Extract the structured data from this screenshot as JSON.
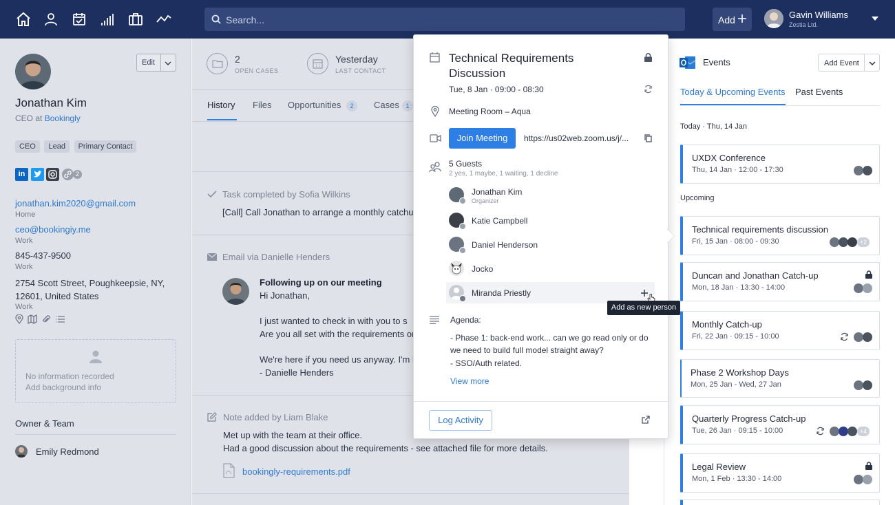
{
  "topbar": {
    "search_placeholder": "Search...",
    "add_label": "Add",
    "user_name": "Gavin Williams",
    "user_company": "Zestia Ltd."
  },
  "contact": {
    "edit_label": "Edit",
    "name": "Jonathan Kim",
    "role_prefix": "CEO at",
    "company": "Bookingly",
    "tags": [
      "CEO",
      "Lead",
      "Primary Contact"
    ],
    "social_more": "2",
    "email1": "jonathan.kim2020@gmail.com",
    "email1_type": "Home",
    "email2": "ceo@bookingiy.me",
    "email2_type": "Work",
    "phone": "845-437-9500",
    "phone_type": "Work",
    "address_line1": "2754 Scott Street, Poughkeepsie, NY,",
    "address_line2": "12601, United States",
    "address_type": "Work",
    "bg_empty": "No information recorded",
    "bg_add": "Add background info",
    "owner_heading": "Owner & Team",
    "owner_name": "Emily Redmond"
  },
  "stats": {
    "open_cases_value": "2",
    "open_cases_label": "OPEN CASES",
    "last_contact_value": "Yesterday",
    "last_contact_label": "LAST CONTACT"
  },
  "tabs": {
    "history": "History",
    "files": "Files",
    "opportunities": "Opportunities",
    "opportunities_count": "2",
    "cases": "Cases",
    "cases_count": "1"
  },
  "feed": {
    "task_header": "Task completed by Sofia Wilkins",
    "task_body": "[Call] Call Jonathan to arrange a monthly catchup",
    "email_header": "Email via Danielle Henders",
    "email_subject": "Following up on our meeting",
    "email_greeting": "Hi Jonathan,",
    "email_l1": "I just wanted to check in with you to s",
    "email_l2": "Are you all set with the requirements or c",
    "email_l3": "We're here if you need us anyway. I'm lo",
    "email_sign": "- Danielle Henders",
    "note_header": "Note added by Liam Blake",
    "note_l1": "Met up with the team at their office.",
    "note_l2": "Had a good discussion about the requirements - see attached file for more details.",
    "note_file": "bookingly-requirements.pdf"
  },
  "popup": {
    "title_l1": "Technical Requirements",
    "title_l2": "Discussion",
    "datetime": "Tue, 8 Jan · 09:00 - 08:30",
    "location": "Meeting Room – Aqua",
    "join_label": "Join Meeting",
    "zoom_url": "https://us02web.zoom.us/j/...",
    "guests_title": "5 Guests",
    "guests_sub": "2 yes, 1 maybe, 1 waiting, 1 decline",
    "guests": [
      {
        "name": "Jonathan Kim",
        "sub": "Organizer"
      },
      {
        "name": "Katie Campbell",
        "sub": ""
      },
      {
        "name": "Daniel Henderson",
        "sub": ""
      },
      {
        "name": "Jocko",
        "sub": ""
      },
      {
        "name": "Miranda Priestly",
        "sub": ""
      }
    ],
    "tooltip": "Add as new person",
    "agenda_label": "Agenda:",
    "agenda_l1": "- Phase 1: back-end work... can we go read only or do",
    "agenda_l2": "we need to build full model straight away?",
    "agenda_l3": "- SSO/Auth related.",
    "view_more": "View more",
    "log_activity": "Log Activity"
  },
  "events": {
    "title": "Events",
    "add_event": "Add Event",
    "tab_upcoming": "Today & Upcoming Events",
    "tab_past": "Past Events",
    "today_label": "Today · Thu, 14 Jan",
    "upcoming_label": "Upcoming",
    "items": [
      {
        "title": "UXDX Conference",
        "sub": "Thu, 14 Jan · 12:00 - 17:30"
      },
      {
        "title": "Technical requirements discussion",
        "sub": "Fri, 15 Jan · 08:00 - 09:30",
        "more": "+2"
      },
      {
        "title": "Duncan and Jonathan Catch-up",
        "sub": "Mon, 18 Jan · 13:30 - 14:00"
      },
      {
        "title": "Monthly Catch-up",
        "sub": "Fri, 22 Jan · 09:15 - 10:00"
      },
      {
        "title": "Phase 2 Workshop Days",
        "sub": "Mon, 25 Jan - Wed, 27 Jan"
      },
      {
        "title": "Quarterly Progress Catch-up",
        "sub": "Tue, 26 Jan · 09:15 - 10:00",
        "more": "+4"
      },
      {
        "title": "Legal Review",
        "sub": "Mon, 1 Feb · 13:30 - 14:00"
      }
    ]
  },
  "colors": {
    "topbar": "#1c2f5e",
    "accent": "#2d7ee5",
    "overlay": "#dfe2e8"
  }
}
